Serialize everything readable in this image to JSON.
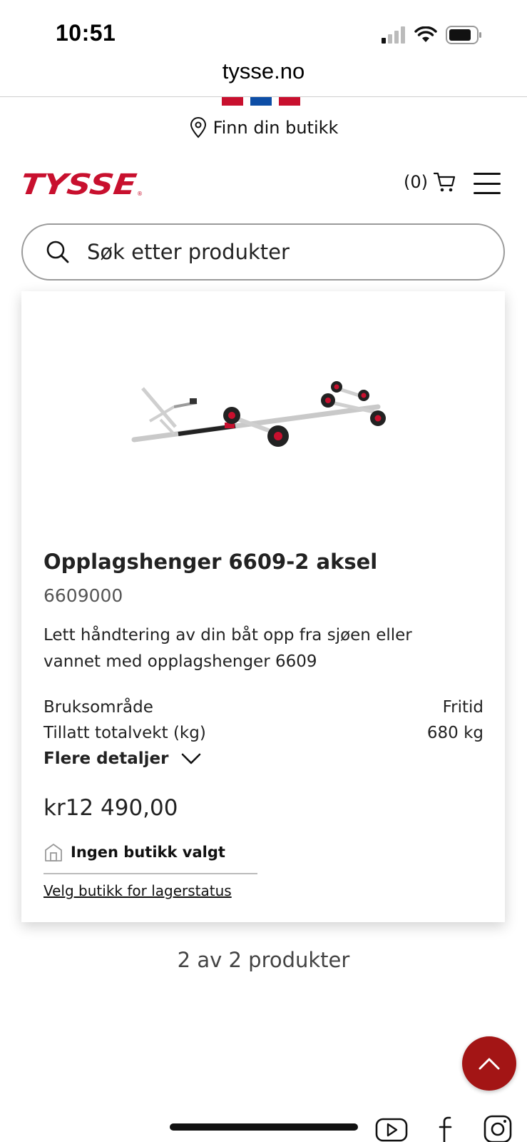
{
  "status_bar": {
    "time": "10:51"
  },
  "browser": {
    "url": "tysse.no"
  },
  "header": {
    "find_store": "Finn din butikk",
    "logo_text": "TYSSE",
    "cart_count": "(0)",
    "brand_color": "#c8102e"
  },
  "search": {
    "placeholder": "Søk etter produkter"
  },
  "product": {
    "title": "Opplagshenger 6609-2 aksel",
    "sku": "6609000",
    "description": "Lett håndtering av din båt opp fra sjøen eller vannet med opplagshenger 6609",
    "specs": [
      {
        "label": "Bruksområde",
        "value": "Fritid"
      },
      {
        "label": "Tillatt totalvekt (kg)",
        "value": "680 kg"
      }
    ],
    "more_details": "Flere detaljer",
    "price": "kr12 490,00",
    "store_status": "Ingen butikk valgt",
    "choose_store": "Velg butikk for lagerstatus"
  },
  "listing": {
    "count_text": "2 av 2 produkter"
  },
  "colors": {
    "accent": "#a31515",
    "flag_red": "#c8102e",
    "flag_blue": "#0d4ea6"
  },
  "icons": [
    "signal-icon",
    "wifi-icon",
    "battery-icon",
    "location-pin-icon",
    "cart-icon",
    "menu-icon",
    "search-icon",
    "chevron-down-icon",
    "store-icon",
    "chevron-up-icon",
    "youtube-icon",
    "facebook-icon",
    "instagram-icon"
  ]
}
